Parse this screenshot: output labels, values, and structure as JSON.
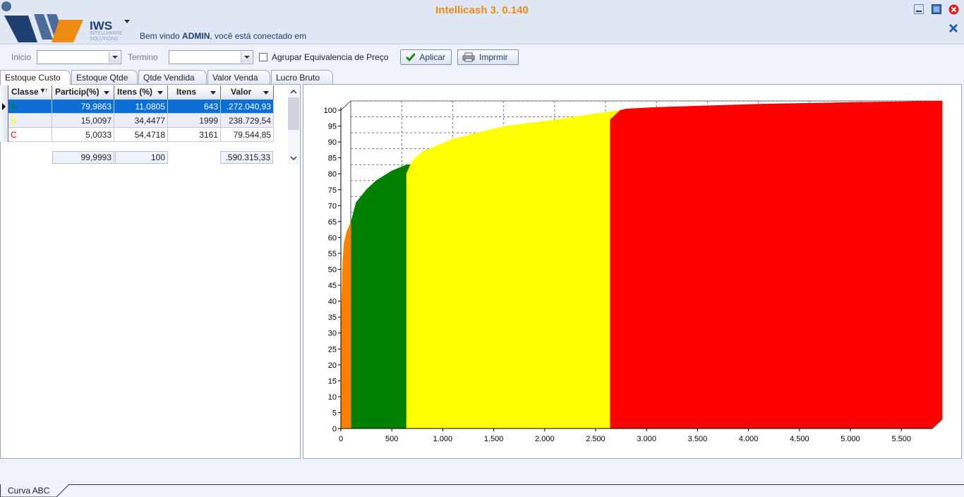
{
  "app": {
    "title": "Intellicash 3. 0.140",
    "brand": "IWS",
    "brand_sub_1": "INTELLIWARE",
    "brand_sub_2": "SOLUTIONS",
    "welcome_prefix": "Bem vindo ",
    "welcome_user": "ADMIN",
    "welcome_suffix": ", você está conectado em"
  },
  "toolbar": {
    "inicio_label": "Inicio",
    "inicio_value": "",
    "termino_label": "Termino",
    "termino_value": "",
    "agrupar_label": "Agrupar Equivalencia de Preço",
    "agrupar_checked": false,
    "aplicar_label": "Aplicar",
    "imprimir_label": "Imprmir"
  },
  "tabs": [
    "Estoque Custo",
    "Estoque Qtde",
    "Qtde Vendida",
    "Valor Venda",
    "Lucro Bruto"
  ],
  "active_tab": "Estoque Custo",
  "grid": {
    "columns": [
      "Classe",
      "Particip(%)",
      "Itens (%)",
      "Itens",
      "Valor"
    ],
    "rows": [
      {
        "classe": "A",
        "particip": "79,9863",
        "itens_pct": "11,0805",
        "itens": "643",
        "valor": ".272.040,93",
        "color": "#008000",
        "selected": true
      },
      {
        "classe": "B",
        "particip": "15,0097",
        "itens_pct": "34,4477",
        "itens": "1999",
        "valor": "238.729,54",
        "color": "#ffff00",
        "selected": false
      },
      {
        "classe": "C",
        "particip": "5,0033",
        "itens_pct": "54,4718",
        "itens": "3161",
        "valor": "79.544,85",
        "color": "#ff0000",
        "selected": false
      }
    ],
    "totals": {
      "particip": "99,9993",
      "itens_pct": "100",
      "valor": ".590.315,33"
    }
  },
  "chart_data": {
    "type": "area",
    "title": "",
    "xlabel": "",
    "ylabel": "",
    "xlim": [
      0,
      5803
    ],
    "ylim": [
      0,
      100
    ],
    "x_ticks": [
      "0",
      "500",
      "1.000",
      "1.500",
      "2.000",
      "2.500",
      "3.000",
      "3.500",
      "4.000",
      "4.500",
      "5.000",
      "5.500"
    ],
    "y_ticks": [
      "0",
      "5",
      "10",
      "15",
      "20",
      "25",
      "30",
      "35",
      "40",
      "45",
      "50",
      "55",
      "60",
      "65",
      "70",
      "75",
      "80",
      "85",
      "90",
      "95",
      "100"
    ],
    "grid": true,
    "style": "3d",
    "series": [
      {
        "color": "#ff8000",
        "x": [
          0,
          6,
          12,
          18,
          30,
          60,
          100
        ],
        "y": [
          0,
          38,
          45,
          52,
          58,
          62,
          65
        ]
      },
      {
        "color": "#008000",
        "x": [
          100,
          150,
          250,
          400,
          550,
          643
        ],
        "y": [
          65,
          71,
          75,
          78,
          80,
          80
        ]
      },
      {
        "color": "#ffff00",
        "x": [
          643,
          700,
          1000,
          1500,
          2000,
          2400,
          2642
        ],
        "y": [
          80,
          84,
          88,
          92,
          94,
          96,
          97
        ]
      },
      {
        "color": "#ff0000",
        "x": [
          2642,
          2700,
          3000,
          3500,
          4000,
          4500,
          5000,
          5500,
          5803
        ],
        "y": [
          97,
          97.5,
          98,
          98.5,
          99,
          99.3,
          99.6,
          99.8,
          100
        ]
      }
    ]
  },
  "bottom_tab": "Curva ABC"
}
